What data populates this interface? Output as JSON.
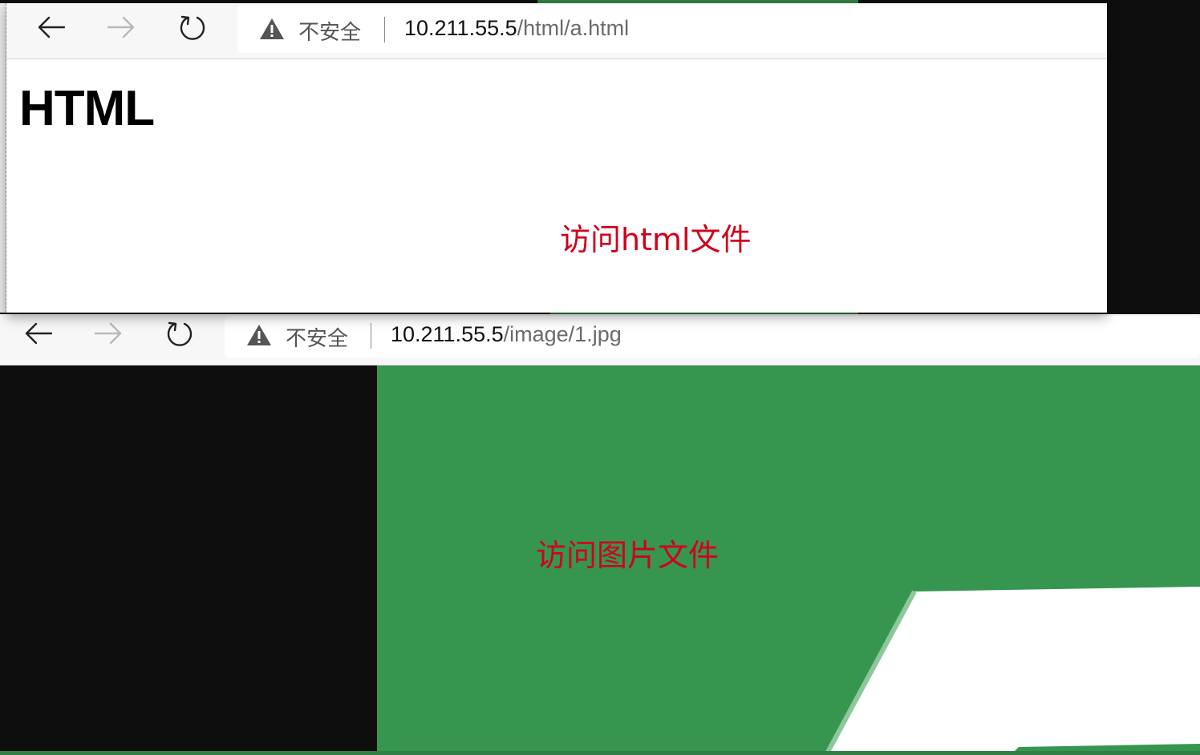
{
  "window_html": {
    "nav": {
      "back": "back-arrow",
      "forward": "forward-arrow",
      "reload": "reload"
    },
    "security_label": "不安全",
    "url_host": "10.211.55.5",
    "url_path": "/html/a.html",
    "page_heading": "HTML",
    "annotation": "访问html文件"
  },
  "window_image": {
    "nav": {
      "back": "back-arrow",
      "forward": "forward-arrow",
      "reload": "reload"
    },
    "security_label": "不安全",
    "url_host": "10.211.55.5",
    "url_path": "/image/1.jpg",
    "annotation": "访问图片文件"
  },
  "colors": {
    "image_green": "#36964f",
    "annotation_red": "#d0001c",
    "background_dark": "#0e0e0e"
  },
  "icons": [
    "back-arrow-icon",
    "forward-arrow-icon",
    "reload-icon",
    "warning-icon"
  ]
}
